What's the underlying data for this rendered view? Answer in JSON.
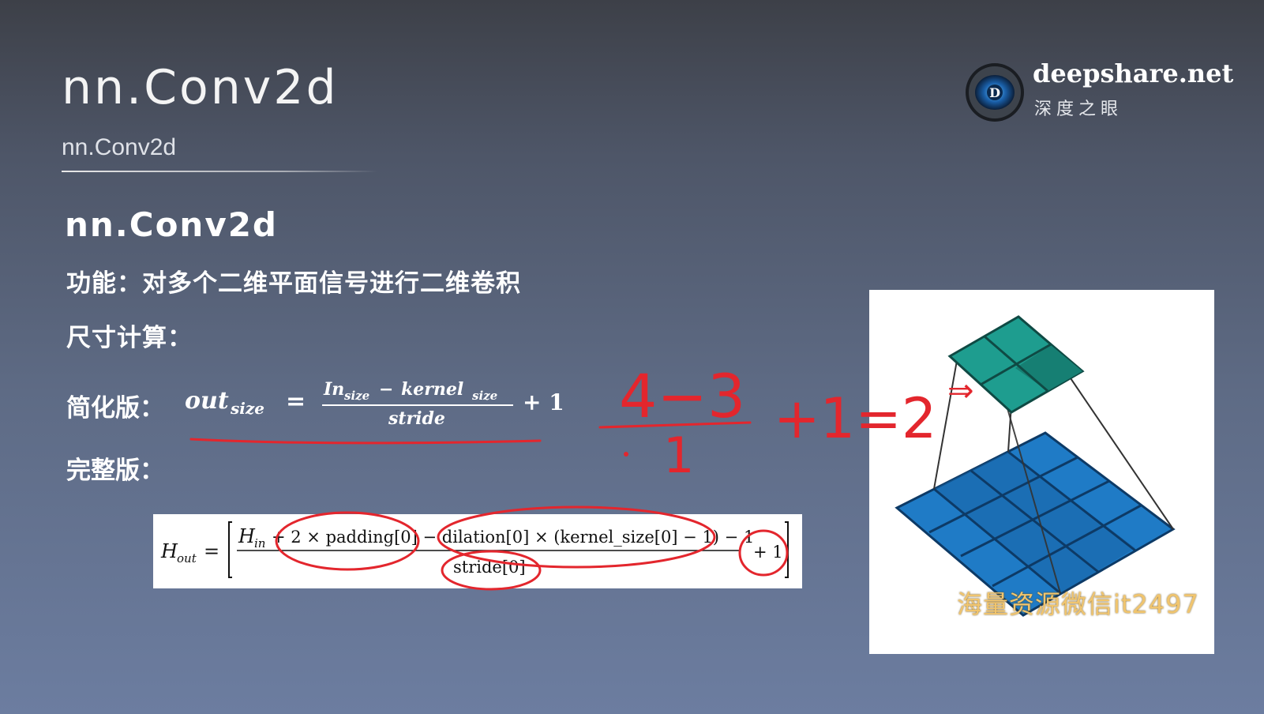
{
  "slide": {
    "title": "nn.Conv2d",
    "subtitle": "nn.Conv2d",
    "section_heading": "nn.Conv2d",
    "function_line": "功能：对多个二维平面信号进行二维卷积",
    "size_calc_label": "尺寸计算：",
    "simple_label": "简化版：",
    "full_label": "完整版："
  },
  "brand": {
    "name": "deepshare.net",
    "subtitle": "深度之眼",
    "logo_letter": "D"
  },
  "simple_formula": {
    "lhs_base": "out",
    "lhs_sub": "size",
    "equals": "=",
    "num_in": "In",
    "num_in_sub": "size",
    "num_minus": " −",
    "num_kernel": "kernel",
    "num_kernel_sub": "size",
    "denominator": "stride",
    "plus_one": "+ 1"
  },
  "full_formula": {
    "lhs": "H",
    "lhs_sub": "out",
    "equals": "=",
    "numerator_h": "H",
    "numerator_h_sub": "in",
    "numerator_rest": "+ 2 × padding[0] − dilation[0] × (kernel_size[0] − 1) − 1",
    "denominator": "stride[0]",
    "plus_one": "+ 1"
  },
  "handwriting": {
    "numerator": "4−3",
    "denominator": "1",
    "tail": "+1=2",
    "arrow": "⇒"
  },
  "watermark": "海量资源微信it2497",
  "colors": {
    "annotation": "#e3262d",
    "top_grid": "#1e9d8f",
    "top_grid_dark": "#167f73",
    "bottom_grid": "#1f7bc6",
    "bottom_grid_dark": "#1765a6",
    "watermark": "#f1c56e"
  }
}
